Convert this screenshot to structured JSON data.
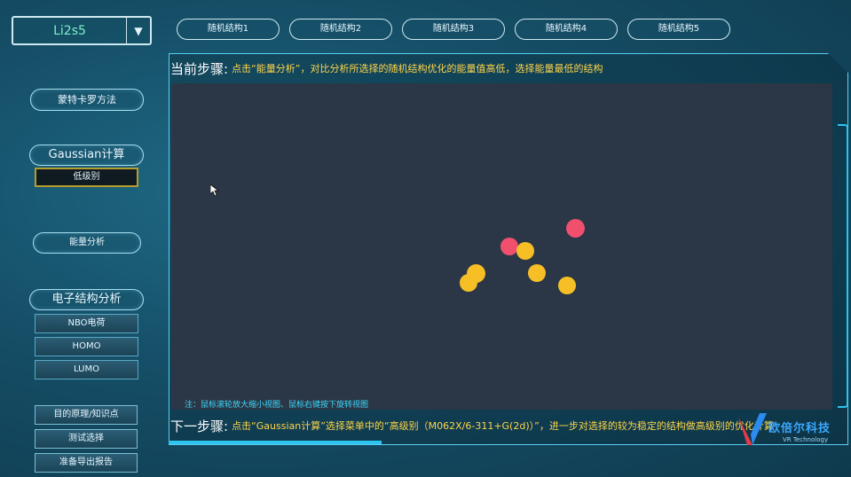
{
  "molecule_select": {
    "value": "Li2s5"
  },
  "structure_tabs": [
    "随机结构1",
    "随机结构2",
    "随机结构3",
    "随机结构4",
    "随机结构5"
  ],
  "left_menu": {
    "monte_carlo": "蒙特卡罗方法",
    "gaussian": "Gaussian计算",
    "low_level": "低级别",
    "energy": "能量分析",
    "electronic": "电子结构分析",
    "nbo": "NBO电荷",
    "homo": "HOMO",
    "lumo": "LUMO",
    "purpose": "目的原理/知识点",
    "test": "测试选择",
    "report": "准备导出报告"
  },
  "main": {
    "current_label": "当前步骤:",
    "current_text": "点击“能量分析”，对比分析所选择的随机结构优化的能量值高低，选择能量最低的结构",
    "note": "注：鼠标滚轮放大缩小视图、鼠标右键按下旋转视图",
    "next_label": "下一步骤:",
    "next_text": "点击“Gaussian计算”选择菜单中的“高级别（M062X/6-311+G(2d)）”，进一步对选择的较为稳定的结构做高级别的优化计算"
  },
  "atoms": [
    {
      "element": "Li",
      "color": "#f0506e"
    },
    {
      "element": "Li",
      "color": "#f0506e"
    },
    {
      "element": "S",
      "color": "#f6bf26"
    },
    {
      "element": "S",
      "color": "#f6bf26"
    },
    {
      "element": "S",
      "color": "#f6bf26"
    },
    {
      "element": "S",
      "color": "#f6bf26"
    },
    {
      "element": "S",
      "color": "#f6bf26"
    }
  ],
  "logo": {
    "name": "欧倍尔科技",
    "tagline": "VR Technology"
  }
}
